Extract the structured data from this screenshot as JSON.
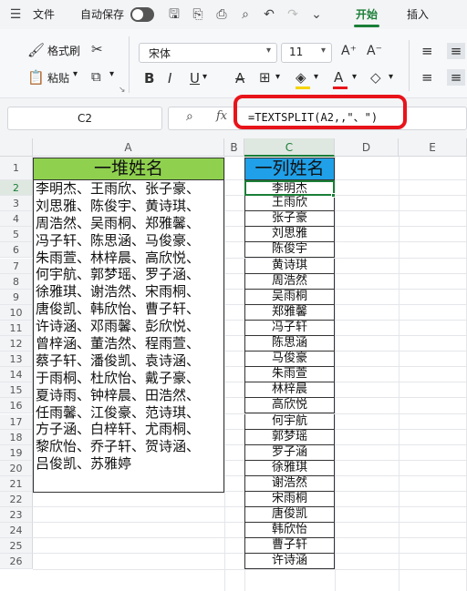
{
  "titlebar": {
    "menu_label": "文件",
    "autosave_label": "自动保存",
    "tabs": [
      "开始",
      "插入"
    ]
  },
  "ribbon": {
    "format_painter": "格式刷",
    "paste": "粘贴",
    "font_name": "宋体",
    "font_size": "11",
    "grow_font": "A⁺",
    "shrink_font": "A⁻",
    "bold": "B",
    "italic": "I",
    "underline": "U",
    "strike": "A"
  },
  "formula_bar": {
    "cell_ref": "C2",
    "fx": "fx",
    "formula": "=TEXTSPLIT(A2,,\"、\")"
  },
  "columns": [
    "A",
    "B",
    "C",
    "D",
    "E"
  ],
  "rows": [
    "1",
    "2",
    "3",
    "4",
    "5",
    "6",
    "7",
    "8",
    "9",
    "10",
    "11",
    "12",
    "13",
    "14",
    "15",
    "16",
    "17",
    "18",
    "19",
    "20",
    "21",
    "22",
    "23",
    "24",
    "25",
    "26"
  ],
  "sheet": {
    "a1": "一堆姓名",
    "c1": "一列姓名",
    "a2_lines": [
      "李明杰、王雨欣、张子豪、",
      "刘思雅、陈俊宇、黄诗琪、",
      "周浩然、吴雨桐、郑雅馨、",
      "冯子轩、陈思涵、马俊豪、",
      "朱雨萱、林梓晨、高欣悦、",
      "何宇航、郭梦瑶、罗子涵、",
      "徐雅琪、谢浩然、宋雨桐、",
      "唐俊凯、韩欣怡、曹子轩、",
      "许诗涵、邓雨馨、彭欣悦、",
      "曾梓涵、董浩然、程雨萱、",
      "蔡子轩、潘俊凯、袁诗涵、",
      "于雨桐、杜欣怡、戴子豪、",
      "夏诗雨、钟梓晨、田浩然、",
      "任雨馨、江俊豪、范诗琪、",
      "方子涵、白梓轩、尤雨桐、",
      "黎欣怡、乔子轩、贺诗涵、",
      "吕俊凯、苏雅婷"
    ],
    "c_values": [
      "李明杰",
      "王雨欣",
      "张子豪",
      "刘思雅",
      "陈俊宇",
      "黄诗琪",
      "周浩然",
      "吴雨桐",
      "郑雅馨",
      "冯子轩",
      "陈思涵",
      "马俊豪",
      "朱雨萱",
      "林梓晨",
      "高欣悦",
      "何宇航",
      "郭梦瑶",
      "罗子涵",
      "徐雅琪",
      "谢浩然",
      "宋雨桐",
      "唐俊凯",
      "韩欣怡",
      "曹子轩",
      "许诗涵"
    ]
  },
  "colors": {
    "accent": "#1a7f37",
    "header_a": "#8fd14f",
    "header_c": "#1fa0e8",
    "highlight_ring": "#e8141a"
  }
}
